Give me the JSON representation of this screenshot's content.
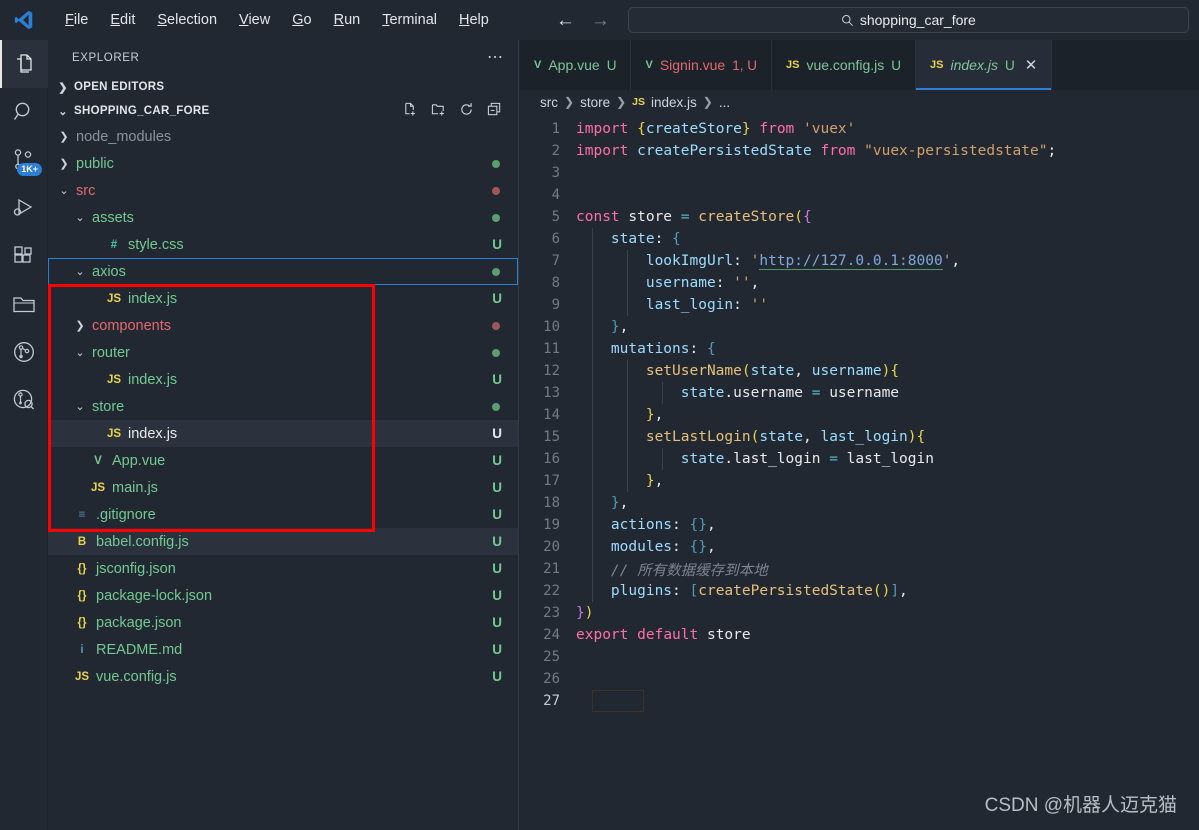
{
  "titlebar": {
    "logo_icon": "vscode-logo-icon",
    "menu": [
      "File",
      "Edit",
      "Selection",
      "View",
      "Go",
      "Run",
      "Terminal",
      "Help"
    ],
    "back_icon": "arrow-left-icon",
    "forward_icon": "arrow-right-icon",
    "search": {
      "icon": "search-icon",
      "value": "shopping_car_fore",
      "placeholder": "Search"
    }
  },
  "activitybar": {
    "items": [
      {
        "name": "explorer",
        "icon": "files-icon",
        "active": true,
        "badge": ""
      },
      {
        "name": "search",
        "icon": "search-icon",
        "active": false,
        "badge": ""
      },
      {
        "name": "source-control",
        "icon": "source-control-icon",
        "active": false,
        "badge": "1K+"
      },
      {
        "name": "run-and-debug",
        "icon": "run-debug-icon",
        "active": false,
        "badge": ""
      },
      {
        "name": "extensions",
        "icon": "extensions-icon",
        "active": false,
        "badge": ""
      },
      {
        "name": "remote-explorer",
        "icon": "folder-icon",
        "active": false,
        "badge": ""
      },
      {
        "name": "gitlens",
        "icon": "gitlens-icon",
        "active": false,
        "badge": ""
      },
      {
        "name": "gitlens-inspect",
        "icon": "gitlens-inspect-icon",
        "active": false,
        "badge": ""
      }
    ]
  },
  "sidebar": {
    "header_title": "EXPLORER",
    "more_icon": "ellipsis-icon",
    "sections": {
      "open_editors": {
        "label": "OPEN EDITORS",
        "expanded": false,
        "chevron": "chevron-right-icon"
      },
      "workspace": {
        "label": "SHOPPING_CAR_FORE",
        "expanded": true,
        "chevron": "chevron-down-icon",
        "actions": [
          "new-file-icon",
          "new-folder-icon",
          "refresh-icon",
          "collapse-all-icon"
        ]
      }
    },
    "tree": [
      {
        "label": "node_modules",
        "type": "folder",
        "expanded": false,
        "depth": 1,
        "color": "gray",
        "icon": "",
        "git": "",
        "dot": ""
      },
      {
        "label": "public",
        "type": "folder",
        "expanded": false,
        "depth": 1,
        "color": "green",
        "icon": "",
        "git": "",
        "dot": "green"
      },
      {
        "label": "src",
        "type": "folder",
        "expanded": true,
        "depth": 1,
        "color": "red",
        "icon": "",
        "git": "",
        "dot": "red"
      },
      {
        "label": "assets",
        "type": "folder",
        "expanded": true,
        "depth": 2,
        "color": "green",
        "icon": "",
        "git": "",
        "dot": "green"
      },
      {
        "label": "style.css",
        "type": "file",
        "depth": 3,
        "color": "green",
        "icon": "#",
        "icon_color": "cyan",
        "git": "U",
        "git_color": "green",
        "dot": ""
      },
      {
        "label": "axios",
        "type": "folder",
        "expanded": true,
        "depth": 2,
        "color": "green",
        "icon": "",
        "git": "",
        "dot": "green",
        "focused": true
      },
      {
        "label": "index.js",
        "type": "file",
        "depth": 3,
        "color": "green",
        "icon": "JS",
        "icon_color": "yellow",
        "git": "U",
        "git_color": "green",
        "dot": ""
      },
      {
        "label": "components",
        "type": "folder",
        "expanded": false,
        "depth": 2,
        "color": "red",
        "icon": "",
        "git": "",
        "dot": "red"
      },
      {
        "label": "router",
        "type": "folder",
        "expanded": true,
        "depth": 2,
        "color": "green",
        "icon": "",
        "git": "",
        "dot": "green"
      },
      {
        "label": "index.js",
        "type": "file",
        "depth": 3,
        "color": "green",
        "icon": "JS",
        "icon_color": "yellow",
        "git": "U",
        "git_color": "green",
        "dot": ""
      },
      {
        "label": "store",
        "type": "folder",
        "expanded": true,
        "depth": 2,
        "color": "green",
        "icon": "",
        "git": "",
        "dot": "green"
      },
      {
        "label": "index.js",
        "type": "file",
        "depth": 3,
        "color": "white",
        "icon": "JS",
        "icon_color": "yellow",
        "git": "U",
        "git_color": "white",
        "dot": "",
        "selected": true
      },
      {
        "label": "App.vue",
        "type": "file",
        "depth": 2,
        "color": "green",
        "icon": "V",
        "icon_color": "green",
        "git": "U",
        "git_color": "green",
        "dot": ""
      },
      {
        "label": "main.js",
        "type": "file",
        "depth": 2,
        "color": "green",
        "icon": "JS",
        "icon_color": "yellow",
        "git": "U",
        "git_color": "green",
        "dot": ""
      },
      {
        "label": ".gitignore",
        "type": "file",
        "depth": 1,
        "color": "green",
        "icon": "≡",
        "icon_color": "blue",
        "git": "U",
        "git_color": "green",
        "dot": ""
      },
      {
        "label": "babel.config.js",
        "type": "file",
        "depth": 1,
        "color": "green",
        "icon": "B",
        "icon_color": "yellow",
        "git": "U",
        "git_color": "green",
        "dot": "",
        "selected": true
      },
      {
        "label": "jsconfig.json",
        "type": "file",
        "depth": 1,
        "color": "green",
        "icon": "{}",
        "icon_color": "yellow",
        "git": "U",
        "git_color": "green",
        "dot": ""
      },
      {
        "label": "package-lock.json",
        "type": "file",
        "depth": 1,
        "color": "green",
        "icon": "{}",
        "icon_color": "yellow",
        "git": "U",
        "git_color": "green",
        "dot": ""
      },
      {
        "label": "package.json",
        "type": "file",
        "depth": 1,
        "color": "green",
        "icon": "{}",
        "icon_color": "yellow",
        "git": "U",
        "git_color": "green",
        "dot": ""
      },
      {
        "label": "README.md",
        "type": "file",
        "depth": 1,
        "color": "green",
        "icon": "i",
        "icon_color": "blue",
        "git": "U",
        "git_color": "green",
        "dot": ""
      },
      {
        "label": "vue.config.js",
        "type": "file",
        "depth": 1,
        "color": "green",
        "icon": "JS",
        "icon_color": "yellow",
        "git": "U",
        "git_color": "green",
        "dot": ""
      }
    ],
    "annotation_color": "#ff0000",
    "focus_color": "#2b7fd4"
  },
  "editor": {
    "tabs": [
      {
        "name": "App.vue",
        "icon": "vue-icon",
        "icon_text": "V",
        "mark": "U",
        "active": false,
        "error": false,
        "closable": false
      },
      {
        "name": "Signin.vue",
        "icon": "vue-icon",
        "icon_text": "V",
        "mark": "1, U",
        "active": false,
        "error": true,
        "closable": false
      },
      {
        "name": "vue.config.js",
        "icon": "js-icon",
        "icon_text": "JS",
        "mark": "U",
        "active": false,
        "error": false,
        "closable": false
      },
      {
        "name": "index.js",
        "icon": "js-icon",
        "icon_text": "JS",
        "mark": "U",
        "active": true,
        "error": false,
        "closable": true,
        "close_icon": "close-icon"
      }
    ],
    "breadcrumb": [
      "src",
      "store",
      "index.js",
      "..."
    ],
    "breadcrumb_file_icon": "js-icon",
    "active_line": 27,
    "total_lines": 27,
    "code_lines": [
      {
        "n": 1,
        "tokens": [
          {
            "t": "import",
            "c": "kw"
          },
          {
            "t": " ",
            "c": "pln"
          },
          {
            "t": "{",
            "c": "br1"
          },
          {
            "t": "createStore",
            "c": "var"
          },
          {
            "t": "}",
            "c": "br1"
          },
          {
            "t": " ",
            "c": "pln"
          },
          {
            "t": "from",
            "c": "kw"
          },
          {
            "t": " ",
            "c": "pln"
          },
          {
            "t": "'vuex'",
            "c": "str"
          }
        ]
      },
      {
        "n": 2,
        "tokens": [
          {
            "t": "import",
            "c": "kw"
          },
          {
            "t": " ",
            "c": "pln"
          },
          {
            "t": "createPersistedState",
            "c": "var"
          },
          {
            "t": " ",
            "c": "pln"
          },
          {
            "t": "from",
            "c": "kw"
          },
          {
            "t": " ",
            "c": "pln"
          },
          {
            "t": "\"vuex-persistedstate\"",
            "c": "str"
          },
          {
            "t": ";",
            "c": "pln"
          }
        ]
      },
      {
        "n": 3,
        "tokens": []
      },
      {
        "n": 4,
        "tokens": []
      },
      {
        "n": 5,
        "tokens": [
          {
            "t": "const",
            "c": "kw"
          },
          {
            "t": " ",
            "c": "pln"
          },
          {
            "t": "store",
            "c": "pln"
          },
          {
            "t": " ",
            "c": "pln"
          },
          {
            "t": "=",
            "c": "op"
          },
          {
            "t": " ",
            "c": "pln"
          },
          {
            "t": "createStore",
            "c": "fn"
          },
          {
            "t": "(",
            "c": "br1"
          },
          {
            "t": "{",
            "c": "br2"
          }
        ]
      },
      {
        "n": 6,
        "tokens": [
          {
            "t": "    ",
            "c": "pln"
          },
          {
            "t": "state",
            "c": "var"
          },
          {
            "t": ": ",
            "c": "pln"
          },
          {
            "t": "{",
            "c": "br3"
          }
        ]
      },
      {
        "n": 7,
        "tokens": [
          {
            "t": "        ",
            "c": "pln"
          },
          {
            "t": "lookImgUrl",
            "c": "var"
          },
          {
            "t": ": ",
            "c": "pln"
          },
          {
            "t": "'",
            "c": "str"
          },
          {
            "t": "http://127.0.0.1:8000",
            "c": "url"
          },
          {
            "t": "'",
            "c": "str"
          },
          {
            "t": ",",
            "c": "pln"
          }
        ]
      },
      {
        "n": 8,
        "tokens": [
          {
            "t": "        ",
            "c": "pln"
          },
          {
            "t": "username",
            "c": "var"
          },
          {
            "t": ": ",
            "c": "pln"
          },
          {
            "t": "''",
            "c": "str"
          },
          {
            "t": ",",
            "c": "pln"
          }
        ]
      },
      {
        "n": 9,
        "tokens": [
          {
            "t": "        ",
            "c": "pln"
          },
          {
            "t": "last_login",
            "c": "var"
          },
          {
            "t": ": ",
            "c": "pln"
          },
          {
            "t": "''",
            "c": "str"
          }
        ]
      },
      {
        "n": 10,
        "tokens": [
          {
            "t": "    ",
            "c": "pln"
          },
          {
            "t": "}",
            "c": "br3"
          },
          {
            "t": ",",
            "c": "pln"
          }
        ]
      },
      {
        "n": 11,
        "tokens": [
          {
            "t": "    ",
            "c": "pln"
          },
          {
            "t": "mutations",
            "c": "var"
          },
          {
            "t": ": ",
            "c": "pln"
          },
          {
            "t": "{",
            "c": "br3"
          }
        ]
      },
      {
        "n": 12,
        "tokens": [
          {
            "t": "        ",
            "c": "pln"
          },
          {
            "t": "setUserName",
            "c": "fn"
          },
          {
            "t": "(",
            "c": "br1"
          },
          {
            "t": "state",
            "c": "var"
          },
          {
            "t": ", ",
            "c": "pln"
          },
          {
            "t": "username",
            "c": "var"
          },
          {
            "t": ")",
            "c": "br1"
          },
          {
            "t": "{",
            "c": "br1"
          }
        ]
      },
      {
        "n": 13,
        "tokens": [
          {
            "t": "            ",
            "c": "pln"
          },
          {
            "t": "state",
            "c": "var"
          },
          {
            "t": ".username",
            "c": "pln"
          },
          {
            "t": " ",
            "c": "pln"
          },
          {
            "t": "=",
            "c": "op"
          },
          {
            "t": " ",
            "c": "pln"
          },
          {
            "t": "username",
            "c": "pln"
          }
        ]
      },
      {
        "n": 14,
        "tokens": [
          {
            "t": "        ",
            "c": "pln"
          },
          {
            "t": "}",
            "c": "br1"
          },
          {
            "t": ",",
            "c": "pln"
          }
        ]
      },
      {
        "n": 15,
        "tokens": [
          {
            "t": "        ",
            "c": "pln"
          },
          {
            "t": "setLastLogin",
            "c": "fn"
          },
          {
            "t": "(",
            "c": "br1"
          },
          {
            "t": "state",
            "c": "var"
          },
          {
            "t": ", ",
            "c": "pln"
          },
          {
            "t": "last_login",
            "c": "var"
          },
          {
            "t": ")",
            "c": "br1"
          },
          {
            "t": "{",
            "c": "br1"
          }
        ]
      },
      {
        "n": 16,
        "tokens": [
          {
            "t": "            ",
            "c": "pln"
          },
          {
            "t": "state",
            "c": "var"
          },
          {
            "t": ".last_login",
            "c": "pln"
          },
          {
            "t": " ",
            "c": "pln"
          },
          {
            "t": "=",
            "c": "op"
          },
          {
            "t": " ",
            "c": "pln"
          },
          {
            "t": "last_login",
            "c": "pln"
          }
        ]
      },
      {
        "n": 17,
        "tokens": [
          {
            "t": "        ",
            "c": "pln"
          },
          {
            "t": "}",
            "c": "br1"
          },
          {
            "t": ",",
            "c": "pln"
          }
        ]
      },
      {
        "n": 18,
        "tokens": [
          {
            "t": "    ",
            "c": "pln"
          },
          {
            "t": "}",
            "c": "br3"
          },
          {
            "t": ",",
            "c": "pln"
          }
        ]
      },
      {
        "n": 19,
        "tokens": [
          {
            "t": "    ",
            "c": "pln"
          },
          {
            "t": "actions",
            "c": "var"
          },
          {
            "t": ": ",
            "c": "pln"
          },
          {
            "t": "{}",
            "c": "br3"
          },
          {
            "t": ",",
            "c": "pln"
          }
        ]
      },
      {
        "n": 20,
        "tokens": [
          {
            "t": "    ",
            "c": "pln"
          },
          {
            "t": "modules",
            "c": "var"
          },
          {
            "t": ": ",
            "c": "pln"
          },
          {
            "t": "{}",
            "c": "br3"
          },
          {
            "t": ",",
            "c": "pln"
          }
        ]
      },
      {
        "n": 21,
        "tokens": [
          {
            "t": "    ",
            "c": "pln"
          },
          {
            "t": "// 所有数据缓存到本地",
            "c": "cmt"
          }
        ]
      },
      {
        "n": 22,
        "tokens": [
          {
            "t": "    ",
            "c": "pln"
          },
          {
            "t": "plugins",
            "c": "var"
          },
          {
            "t": ": ",
            "c": "pln"
          },
          {
            "t": "[",
            "c": "br3"
          },
          {
            "t": "createPersistedState",
            "c": "fn"
          },
          {
            "t": "(",
            "c": "br1"
          },
          {
            "t": ")",
            "c": "br1"
          },
          {
            "t": "]",
            "c": "br3"
          },
          {
            "t": ",",
            "c": "pln"
          }
        ]
      },
      {
        "n": 23,
        "tokens": [
          {
            "t": "}",
            "c": "br2"
          },
          {
            "t": ")",
            "c": "br1"
          }
        ]
      },
      {
        "n": 24,
        "tokens": [
          {
            "t": "export",
            "c": "kw"
          },
          {
            "t": " ",
            "c": "pln"
          },
          {
            "t": "default",
            "c": "kw"
          },
          {
            "t": " ",
            "c": "pln"
          },
          {
            "t": "store",
            "c": "pln"
          }
        ]
      },
      {
        "n": 25,
        "tokens": []
      },
      {
        "n": 26,
        "tokens": []
      },
      {
        "n": 27,
        "tokens": []
      }
    ]
  },
  "watermark": "CSDN @机器人迈克猫"
}
